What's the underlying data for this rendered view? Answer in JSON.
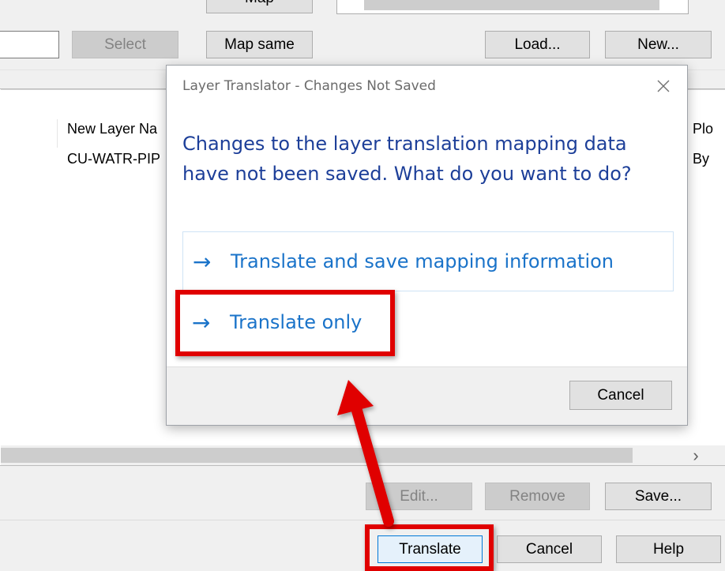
{
  "background": {
    "top_button_partial": "Map",
    "select_button": "Select",
    "map_same_button": "Map same",
    "load_button": "Load...",
    "new_button": "New...",
    "table": {
      "header_new_layer_name": "New Layer Na",
      "header_plot": "Plo",
      "row_new_layer_name": "CU-WATR-PIP",
      "row_plot": "By"
    },
    "scroll_right_arrow": "›",
    "edit_button": "Edit...",
    "remove_button": "Remove",
    "save_button": "Save...",
    "translate_button": "Translate",
    "cancel_button": "Cancel",
    "help_button": "Help"
  },
  "dialog": {
    "title": "Layer Translator - Changes Not Saved",
    "close_symbol": "✕",
    "heading": "Changes to the layer translation mapping data have not been saved. What do you want to do?",
    "options": [
      {
        "arrow": "→",
        "label": "Translate and save mapping information"
      },
      {
        "arrow": "→",
        "label": "Translate only"
      }
    ],
    "cancel_button": "Cancel"
  },
  "colors": {
    "heading": "#1d3f99",
    "option_text": "#1a73c9",
    "annotation_red": "#e00000"
  }
}
